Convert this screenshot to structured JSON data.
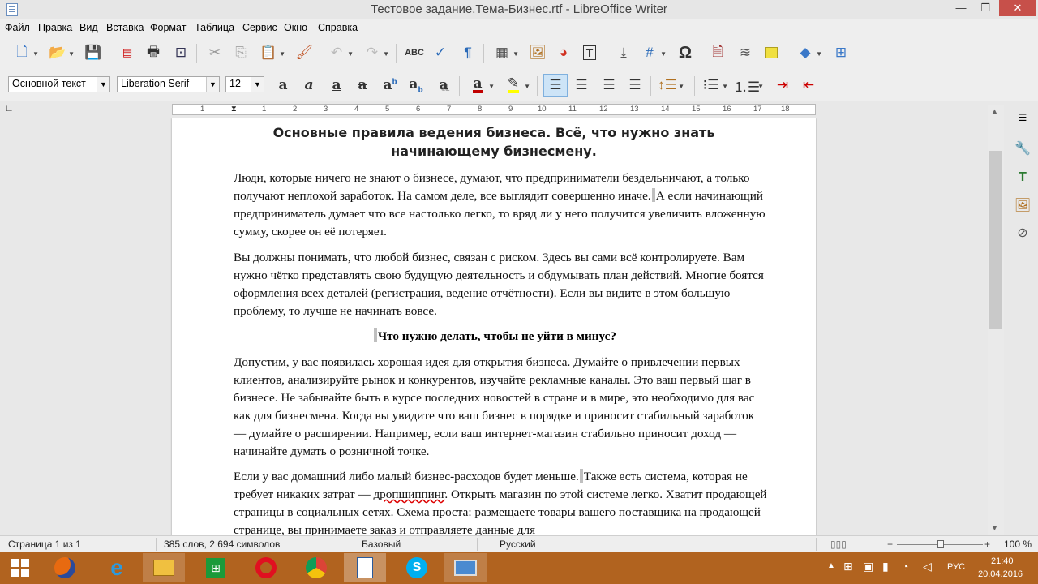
{
  "window": {
    "title": "Тестовое задание.Тема-Бизнес.rtf - LibreOffice Writer",
    "min": "—",
    "max": "❐",
    "close": "✕"
  },
  "menu": [
    "Файл",
    "Правка",
    "Вид",
    "Вставка",
    "Формат",
    "Таблица",
    "Сервис",
    "Окно",
    "Справка"
  ],
  "format": {
    "style": "Основной текст",
    "font": "Liberation Serif",
    "size": "12"
  },
  "ruler": [
    "1",
    "1",
    "2",
    "3",
    "4",
    "5",
    "6",
    "7",
    "8",
    "9",
    "10",
    "11",
    "12",
    "13",
    "14",
    "15",
    "16",
    "17",
    "18"
  ],
  "document": {
    "heading": "Основные правила ведения бизнеса. Всё, что нужно знать начинающему бизнесмену.",
    "p1_a": "Люди, которые ничего не знают о бизнесе, думают, что предприниматели бездельничают, а только получают неплохой заработок. На самом деле, все выглядит совершенно иначе.",
    "p1_b": "А если начинающий предприниматель думает что все настолько легко, то вряд ли у него получится увеличить вложенную сумму, скорее он её потеряет.",
    "p2": "Вы должны понимать, что любой бизнес, связан с риском. Здесь вы сами всё контролируете. Вам нужно чётко представлять свою будущую деятельность и обдумывать план действий. Многие боятся оформления всех деталей (регистрация, ведение отчётности). Если вы видите в этом большую проблему, то лучше не начинать вовсе.",
    "subheading": "Что нужно делать, чтобы не уйти в минус?",
    "p3": "Допустим, у вас появилась хорошая идея для открытия бизнеса. Думайте о привлечении первых клиентов, анализируйте рынок и конкурентов, изучайте рекламные каналы. Это ваш первый шаг в бизнесе. Не забывайте быть в курсе последних новостей в стране и в мире, это необходимо для вас как для бизнесмена. Когда вы увидите что ваш бизнес в порядке и приносит стабильный заработок — думайте о расширении. Например, если ваш интернет-магазин стабильно приносит доход — начинайте думать о розничной точке.",
    "p4_a": "Если у вас домашний либо малый бизнес-расходов будет меньше.",
    "p4_b": "Также есть система, которая не требует никаких затрат —",
    "p4_word": "дропшиппинг",
    "p4_c": ". Открыть магазин по этой системе легко. Хватит продающей страницы в социальных сетях. Схема проста: размещаете товары вашего поставщика на продающей странице, вы принимаете заказ и отправляете данные для"
  },
  "status": {
    "page": "Страница 1 из 1",
    "words": "385 слов, 2 694 символов",
    "style": "Базовый",
    "lang": "Русский",
    "zoom": "100 %"
  },
  "taskbar": {
    "lang": "РУС",
    "time": "21:40",
    "date": "20.04.2016"
  },
  "colors": {
    "font_color": "#c00000",
    "highlight": "#ffff00",
    "taskbar": "#b1631f"
  }
}
